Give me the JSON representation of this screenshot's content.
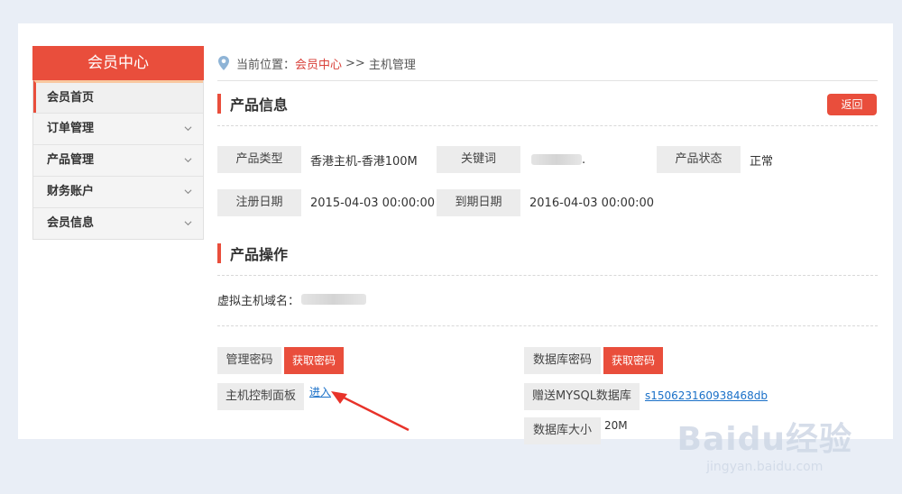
{
  "sidebar": {
    "title": "会员中心",
    "items": [
      {
        "label": "会员首页",
        "active": true
      },
      {
        "label": "订单管理"
      },
      {
        "label": "产品管理"
      },
      {
        "label": "财务账户"
      },
      {
        "label": "会员信息"
      }
    ]
  },
  "breadcrumb": {
    "prefix": "当前位置：",
    "home": "会员中心",
    "separator": ">>",
    "current": "主机管理"
  },
  "product_info": {
    "title": "产品信息",
    "back_button": "返回",
    "fields": {
      "type_label": "产品类型",
      "type_value": "香港主机-香港100M",
      "keyword_label": "关键词",
      "keyword_value": ".",
      "status_label": "产品状态",
      "status_value": "正常",
      "reg_label": "注册日期",
      "reg_value": "2015-04-03 00:00:00",
      "exp_label": "到期日期",
      "exp_value": "2016-04-03 00:00:00"
    }
  },
  "product_ops": {
    "title": "产品操作",
    "domain_label": "虚拟主机域名：",
    "admin_pwd_label": "管理密码",
    "admin_pwd_button": "获取密码",
    "db_pwd_label": "数据库密码",
    "db_pwd_button": "获取密码",
    "panel_label": "主机控制面板",
    "panel_link": "进入",
    "mysql_label": "赠送MYSQL数据库",
    "mysql_link": "s150623160938468db",
    "db_size_label": "数据库大小",
    "db_size_value": "20M"
  },
  "watermark": {
    "brand": "Baidu经验",
    "url": "jingyan.baidu.com"
  },
  "colors": {
    "accent": "#e94e3c",
    "link": "#1a70c8",
    "background": "#e9eef6"
  }
}
